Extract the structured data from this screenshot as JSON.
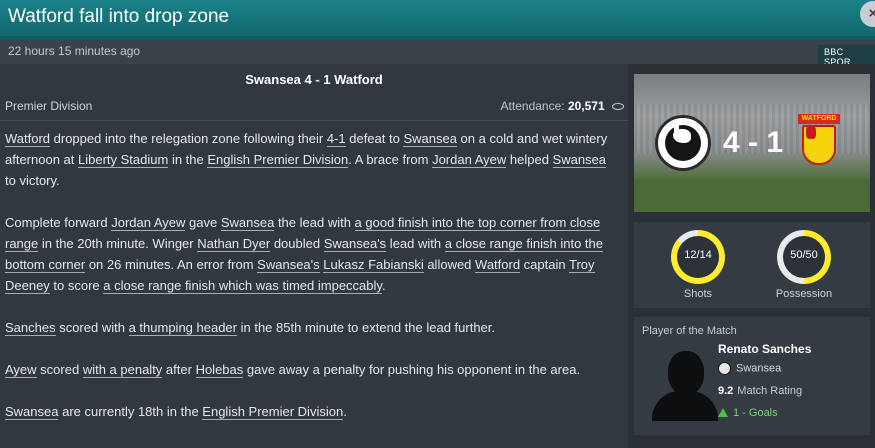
{
  "header": {
    "title": "Watford fall into drop zone",
    "close_symbol": "×"
  },
  "subheader": {
    "time_ago": "22 hours 15 minutes ago",
    "source_badge": "BBC SPOR"
  },
  "match": {
    "headline": "Swansea 4 - 1  Watford",
    "competition": "Premier Division",
    "attendance_label": "Attendance:",
    "attendance_value": "20,571"
  },
  "article": {
    "p1": [
      {
        "t": "Watford",
        "link": true
      },
      {
        "t": " dropped into the relegation zone following their "
      },
      {
        "t": "4-1",
        "link": true
      },
      {
        "t": " defeat to "
      },
      {
        "t": "Swansea",
        "link": true
      },
      {
        "t": " on a cold and wet wintery afternoon at "
      },
      {
        "t": "Liberty Stadium",
        "link": true
      },
      {
        "t": " in the "
      },
      {
        "t": "English Premier Division",
        "link": true
      },
      {
        "t": ". A brace from "
      },
      {
        "t": "Jordan Ayew",
        "link": true
      },
      {
        "t": " helped "
      },
      {
        "t": "Swansea",
        "link": true
      },
      {
        "t": " to victory."
      }
    ],
    "p2": [
      {
        "t": "Complete forward "
      },
      {
        "t": "Jordan Ayew",
        "link": true
      },
      {
        "t": " gave "
      },
      {
        "t": "Swansea",
        "link": true
      },
      {
        "t": " the lead with "
      },
      {
        "t": "a good finish into the top corner from close range",
        "link": true
      },
      {
        "t": " in the 20th minute. Winger "
      },
      {
        "t": "Nathan Dyer",
        "link": true
      },
      {
        "t": " doubled "
      },
      {
        "t": "Swansea's",
        "link": true
      },
      {
        "t": " lead with "
      },
      {
        "t": "a close range finish into the bottom corner",
        "link": true
      },
      {
        "t": " on 26 minutes. An error from "
      },
      {
        "t": "Swansea's",
        "link": true
      },
      {
        "t": " "
      },
      {
        "t": "Lukasz Fabianski",
        "link": true
      },
      {
        "t": " allowed "
      },
      {
        "t": "Watford",
        "link": true
      },
      {
        "t": " captain "
      },
      {
        "t": "Troy Deeney",
        "link": true
      },
      {
        "t": " to score "
      },
      {
        "t": "a close range finish which was timed impeccably",
        "link": true
      },
      {
        "t": "."
      }
    ],
    "p3": [
      {
        "t": "Sanches",
        "link": true
      },
      {
        "t": " scored with "
      },
      {
        "t": "a thumping header",
        "link": true
      },
      {
        "t": " in the 85th minute to extend the lead further."
      }
    ],
    "p4": [
      {
        "t": "Ayew",
        "link": true
      },
      {
        "t": " scored "
      },
      {
        "t": "with a penalty",
        "link": true
      },
      {
        "t": " after "
      },
      {
        "t": "Holebas",
        "link": true
      },
      {
        "t": " gave away a penalty for pushing his opponent in the area."
      }
    ],
    "p5": [
      {
        "t": "Swansea",
        "link": true
      },
      {
        "t": " are currently 18th in the "
      },
      {
        "t": "English Premier Division",
        "link": true
      },
      {
        "t": "."
      }
    ]
  },
  "banner": {
    "score": "4 - 1",
    "home_club": "Swansea City AFC",
    "away_club_text": "WATFORD"
  },
  "stats": {
    "shots": {
      "value": "12/14",
      "fraction": 0.86,
      "label": "Shots"
    },
    "possession": {
      "value": "50/50",
      "fraction": 0.5,
      "label": "Possession"
    }
  },
  "player_of_match": {
    "header": "Player of the Match",
    "name": "Renato Sanches",
    "club": "Swansea",
    "rating_value": "9.2",
    "rating_label": "Match Rating",
    "goals": "1 - Goals"
  },
  "colors": {
    "accent_teal": "#15767c",
    "ring_yellow": "#ffec2e",
    "goals_green": "#4cc14a"
  }
}
